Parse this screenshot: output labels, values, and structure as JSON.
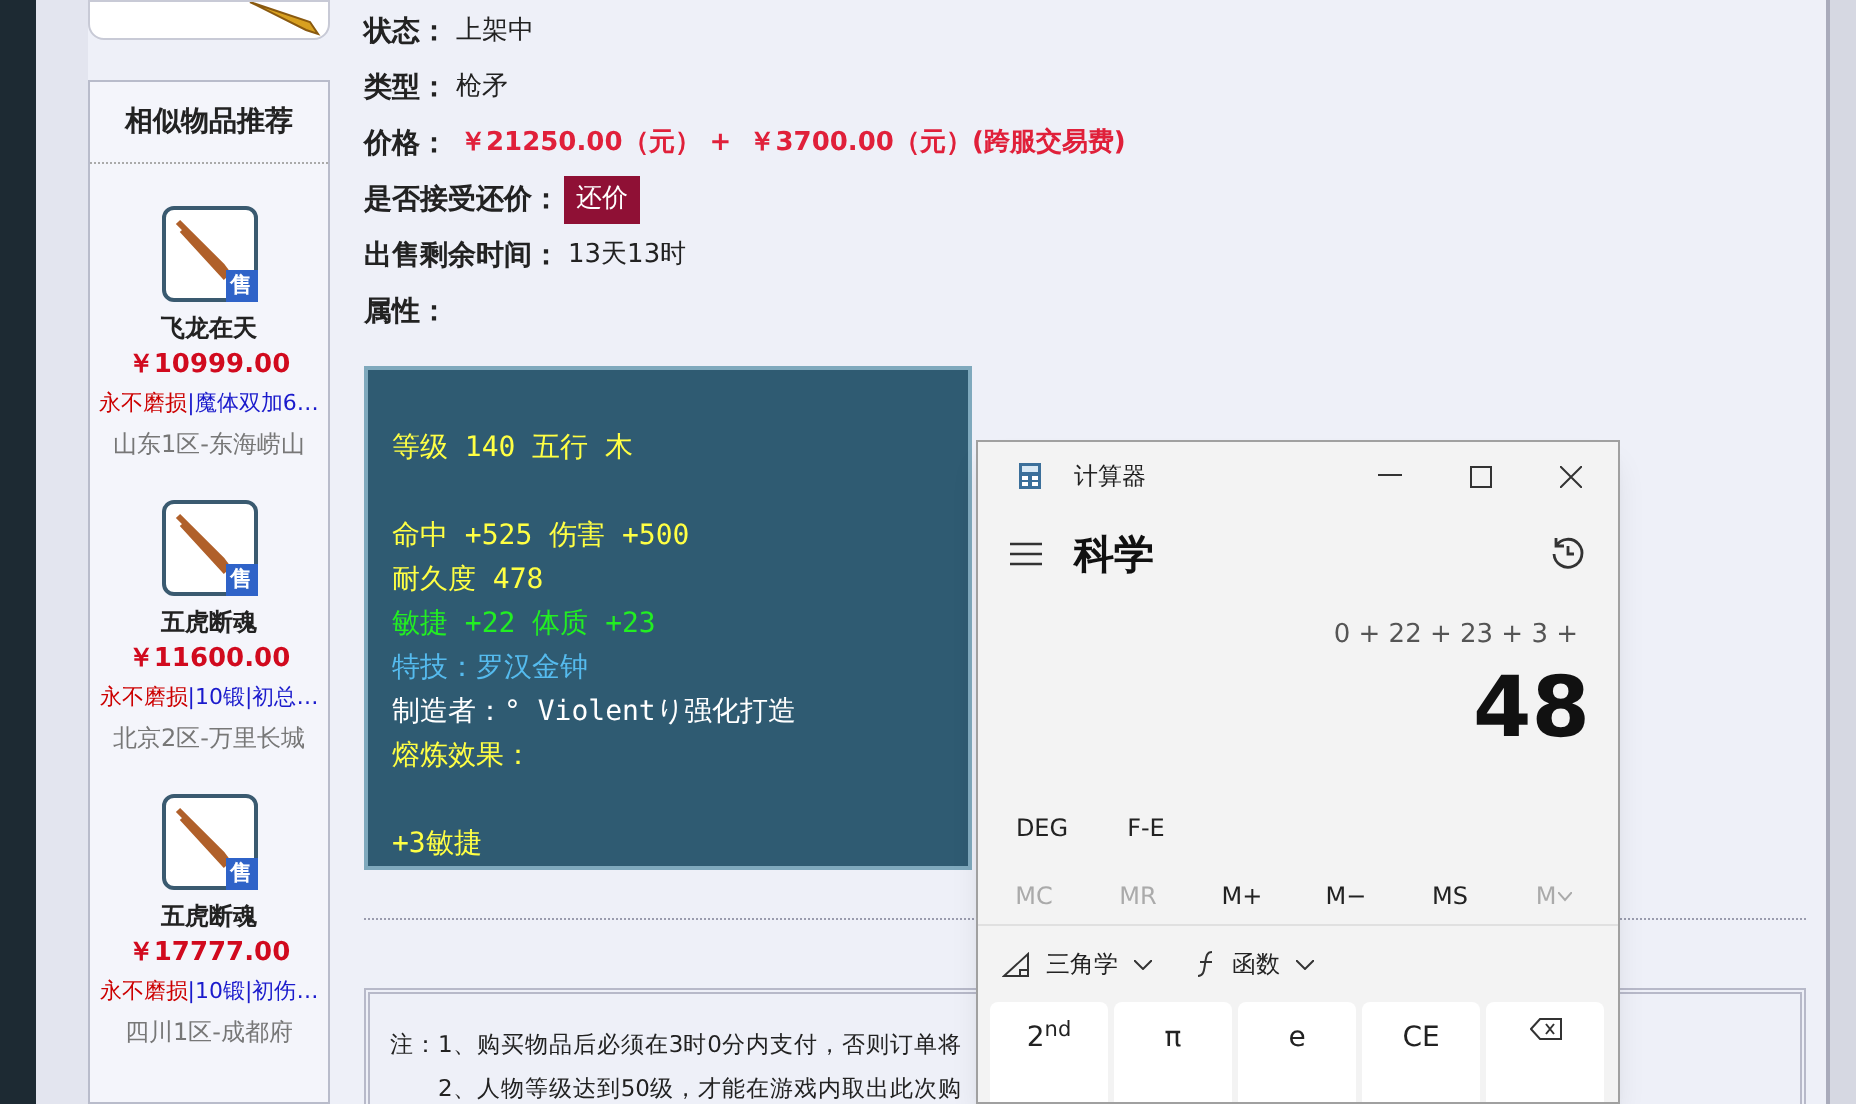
{
  "sidebar": {
    "title": "相似物品推荐",
    "items": [
      {
        "name": "飞龙在天",
        "price": "￥10999.00",
        "badge": "售",
        "tags": [
          {
            "text": "永不磨损",
            "color": "#cc0000"
          },
          {
            "text": "|魔体双加6…",
            "color": "#1a1acc"
          }
        ],
        "server": "山东1区-东海崂山"
      },
      {
        "name": "五虎断魂",
        "price": "￥11600.00",
        "badge": "售",
        "tags": [
          {
            "text": "永不磨损",
            "color": "#cc0000"
          },
          {
            "text": "|10锻",
            "color": "#1a1acc"
          },
          {
            "text": "|初总…",
            "color": "#1a1acc"
          }
        ],
        "server": "北京2区-万里长城"
      },
      {
        "name": "五虎断魂",
        "price": "￥17777.00",
        "badge": "售",
        "tags": [
          {
            "text": "永不磨损",
            "color": "#cc0000"
          },
          {
            "text": "|10锻",
            "color": "#1a1acc"
          },
          {
            "text": "|初伤…",
            "color": "#1a1acc"
          }
        ],
        "server": "四川1区-成都府"
      }
    ]
  },
  "details": [
    {
      "label": "状态：",
      "value": "上架中",
      "kind": "plain"
    },
    {
      "label": "类型：",
      "value": "枪矛",
      "kind": "plain"
    },
    {
      "label": "价格：",
      "value": "￥21250.00（元） +  ￥3700.00（元）(跨服交易费)",
      "kind": "price"
    },
    {
      "label": "是否接受还价：",
      "value": "还价",
      "kind": "button"
    },
    {
      "label": "出售剩余时间：",
      "value": "13天13时",
      "kind": "plain"
    },
    {
      "label": "属性：",
      "kind": "none"
    }
  ],
  "attributes": [
    [
      {
        "text": "等级 140 五行 木",
        "color": "#ffff44"
      }
    ],
    [
      {
        "text": "命中 +525 伤害 +500",
        "color": "#ffff44"
      },
      {
        "text": "耐久度 478",
        "color": "#ffff44"
      },
      {
        "text": "敏捷 +22 体质 +23",
        "color": "#22ee22"
      },
      {
        "text": "特技：罗汉金钟",
        "color": "#55bbee"
      },
      {
        "text": "制造者：° Violentり强化打造",
        "color": "#ffffff"
      },
      {
        "text": "熔炼效果：",
        "color": "#ffff44"
      }
    ],
    [
      {
        "text": "+3敏捷",
        "color": "#ffff44"
      }
    ]
  ],
  "notes": [
    "注：1、购买物品后必须在3时0分内支付，否则订单将",
    "2、人物等级达到50级，才能在游戏内取出此次购"
  ],
  "calculator": {
    "title": "计算器",
    "mode": "科学",
    "expression": "0 + 22 + 23 + 3 +",
    "result": "48",
    "toggles": [
      "DEG",
      "F-E"
    ],
    "memory": [
      {
        "label": "MC",
        "disabled": true,
        "dropdown": false
      },
      {
        "label": "MR",
        "disabled": true,
        "dropdown": false
      },
      {
        "label": "M+",
        "disabled": false,
        "dropdown": false
      },
      {
        "label": "M−",
        "disabled": false,
        "dropdown": false
      },
      {
        "label": "MS",
        "disabled": false,
        "dropdown": false
      },
      {
        "label": "M",
        "disabled": true,
        "dropdown": true
      }
    ],
    "menus": [
      {
        "label": "三角学",
        "kind": "trig"
      },
      {
        "label": "函数",
        "kind": "func"
      }
    ],
    "keys": [
      {
        "label": "2$^{nd}$",
        "kind": "text"
      },
      {
        "label": "π",
        "kind": "text"
      },
      {
        "label": "e",
        "kind": "text"
      },
      {
        "label": "CE",
        "kind": "text"
      },
      {
        "kind": "backspace"
      }
    ]
  }
}
